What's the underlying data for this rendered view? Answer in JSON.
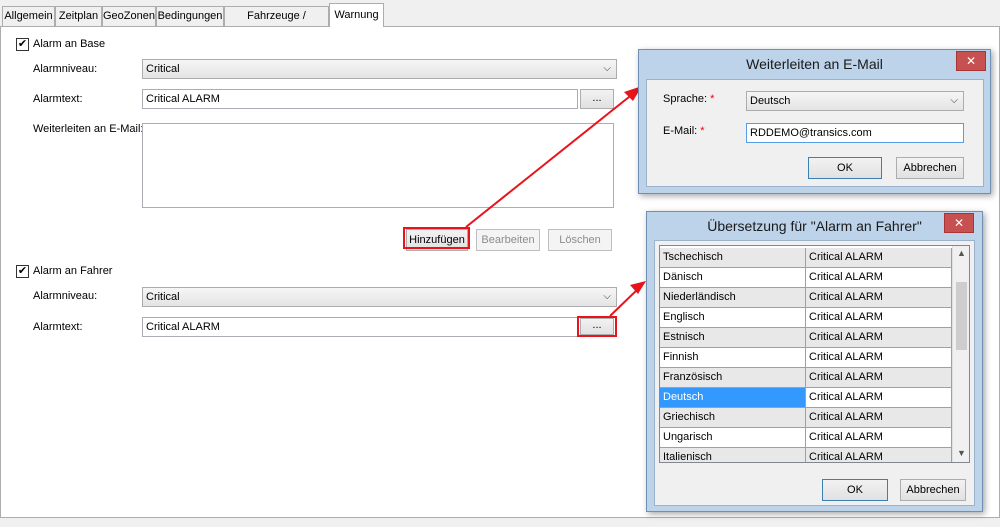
{
  "tabs": [
    {
      "label": "Allgemein"
    },
    {
      "label": "Zeitplan"
    },
    {
      "label": "GeoZonen"
    },
    {
      "label": "Bedingungen"
    },
    {
      "label": "Fahrzeuge / Auflieger"
    },
    {
      "label": "Warnung"
    }
  ],
  "base": {
    "checkbox_label": "Alarm an Base",
    "level_label": "Alarmniveau:",
    "level_value": "Critical",
    "text_label": "Alarmtext:",
    "text_value": "Critical ALARM",
    "email_label": "Weiterleiten an E-Mail:",
    "add_button": "Hinzufügen",
    "edit_button": "Bearbeiten",
    "delete_button": "Löschen"
  },
  "driver": {
    "checkbox_label": "Alarm an Fahrer",
    "level_label": "Alarmniveau:",
    "level_value": "Critical",
    "text_label": "Alarmtext:",
    "text_value": "Critical ALARM"
  },
  "ellipsis": "...",
  "checkmark": "✔",
  "email_dialog": {
    "title": "Weiterleiten an E-Mail",
    "language_label": "Sprache:",
    "language_value": "Deutsch",
    "email_label": "E-Mail:",
    "email_value": "RDDEMO@transics.com",
    "required_mark": "*",
    "ok": "OK",
    "cancel": "Abbrechen",
    "close": "✕"
  },
  "translation_dialog": {
    "title": "Übersetzung für \"Alarm an Fahrer\"",
    "rows": [
      {
        "language": "Tschechisch",
        "text": "Critical ALARM"
      },
      {
        "language": "Dänisch",
        "text": "Critical ALARM"
      },
      {
        "language": "Niederländisch",
        "text": "Critical ALARM"
      },
      {
        "language": "Englisch",
        "text": "Critical ALARM"
      },
      {
        "language": "Estnisch",
        "text": "Critical ALARM"
      },
      {
        "language": "Finnish",
        "text": "Critical ALARM"
      },
      {
        "language": "Französisch",
        "text": "Critical ALARM"
      },
      {
        "language": "Deutsch",
        "text": "Critical ALARM"
      },
      {
        "language": "Griechisch",
        "text": "Critical ALARM"
      },
      {
        "language": "Ungarisch",
        "text": "Critical ALARM"
      },
      {
        "language": "Italienisch",
        "text": "Critical ALARM"
      }
    ],
    "selected_row": 7,
    "ok": "OK",
    "cancel": "Abbrechen",
    "close": "✕"
  },
  "colors": {
    "highlight": "#e8141b",
    "selection": "#3399ff",
    "dialog_frame": "#bcd3ea"
  }
}
